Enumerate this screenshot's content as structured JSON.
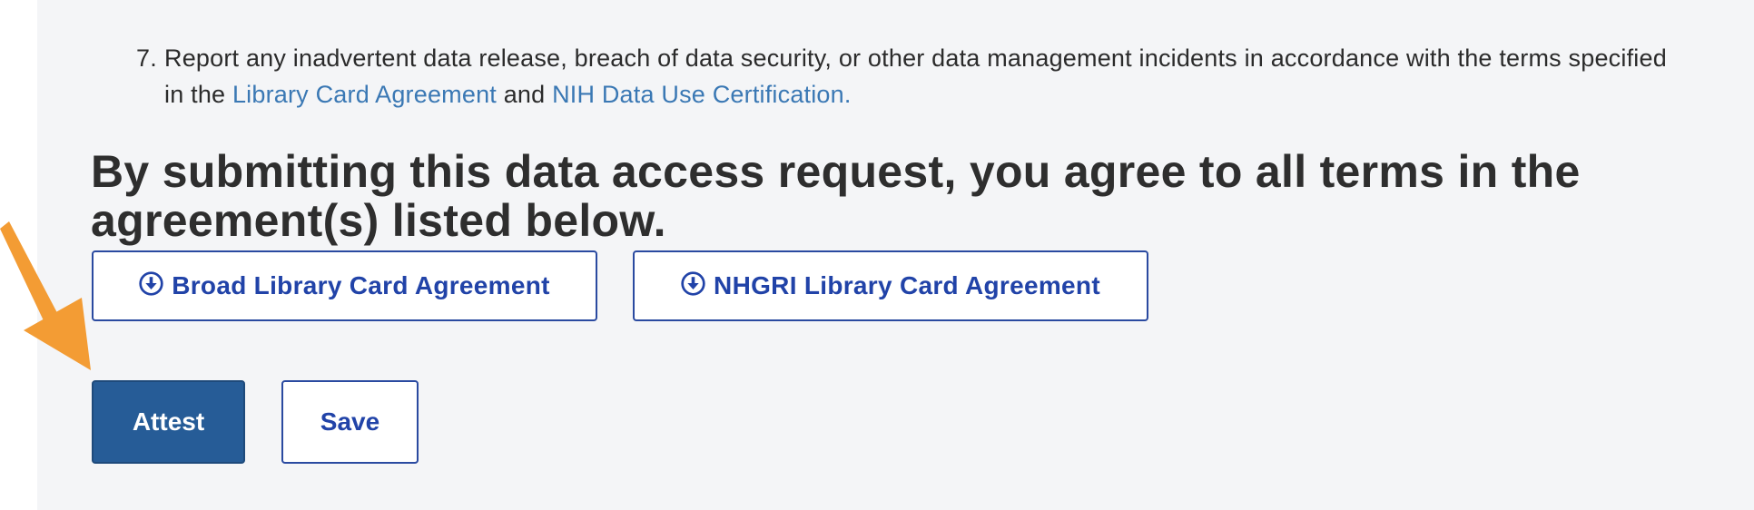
{
  "terms": {
    "item_number": "7.",
    "text_before": "Report any inadvertent data release, breach of data security, or other data management incidents in accordance with the terms specified in the ",
    "link1": "Library Card Agreement",
    "text_between": " and ",
    "link2": "NIH Data Use Certification."
  },
  "agreement": {
    "heading": "By submitting this data access request, you agree to all terms in the agreement(s) listed below.",
    "buttons": [
      {
        "label": "Broad Library Card Agreement",
        "icon": "download-circle-icon"
      },
      {
        "label": "NHGRI Library Card Agreement",
        "icon": "download-circle-icon"
      }
    ]
  },
  "actions": {
    "attest_label": "Attest",
    "save_label": "Save"
  },
  "colors": {
    "primary": "#265c97",
    "outline": "#2a4aa0",
    "link": "#3a78b4",
    "annotation_arrow": "#f39c34",
    "panel_bg": "#f4f5f7"
  }
}
